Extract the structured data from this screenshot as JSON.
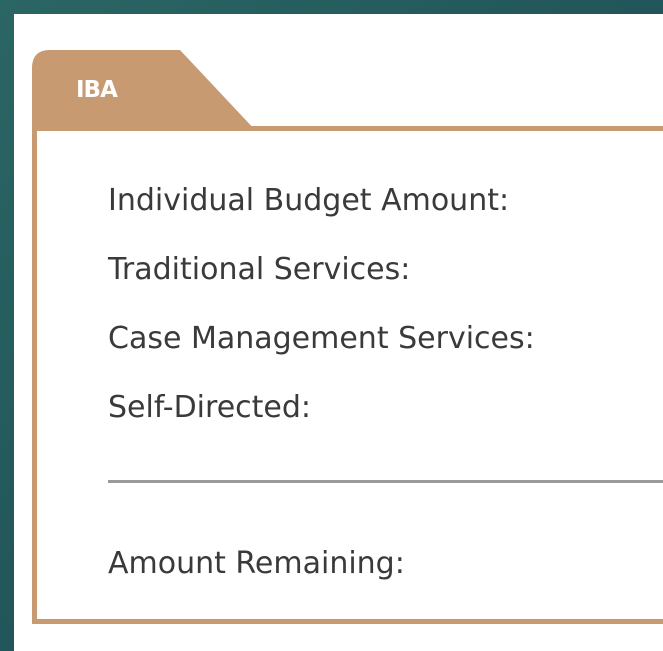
{
  "panel": {
    "tab_title": "IBA",
    "fields": {
      "individual_budget_amount": "Individual Budget Amount:",
      "traditional_services": "Traditional Services:",
      "case_management_services": "Case Management Services:",
      "self_directed": "Self-Directed:",
      "amount_remaining": "Amount Remaining:"
    }
  },
  "colors": {
    "background": "#24585c",
    "accent": "#c89a72",
    "text": "#3a3a3a",
    "divider": "#9a9a9a"
  }
}
